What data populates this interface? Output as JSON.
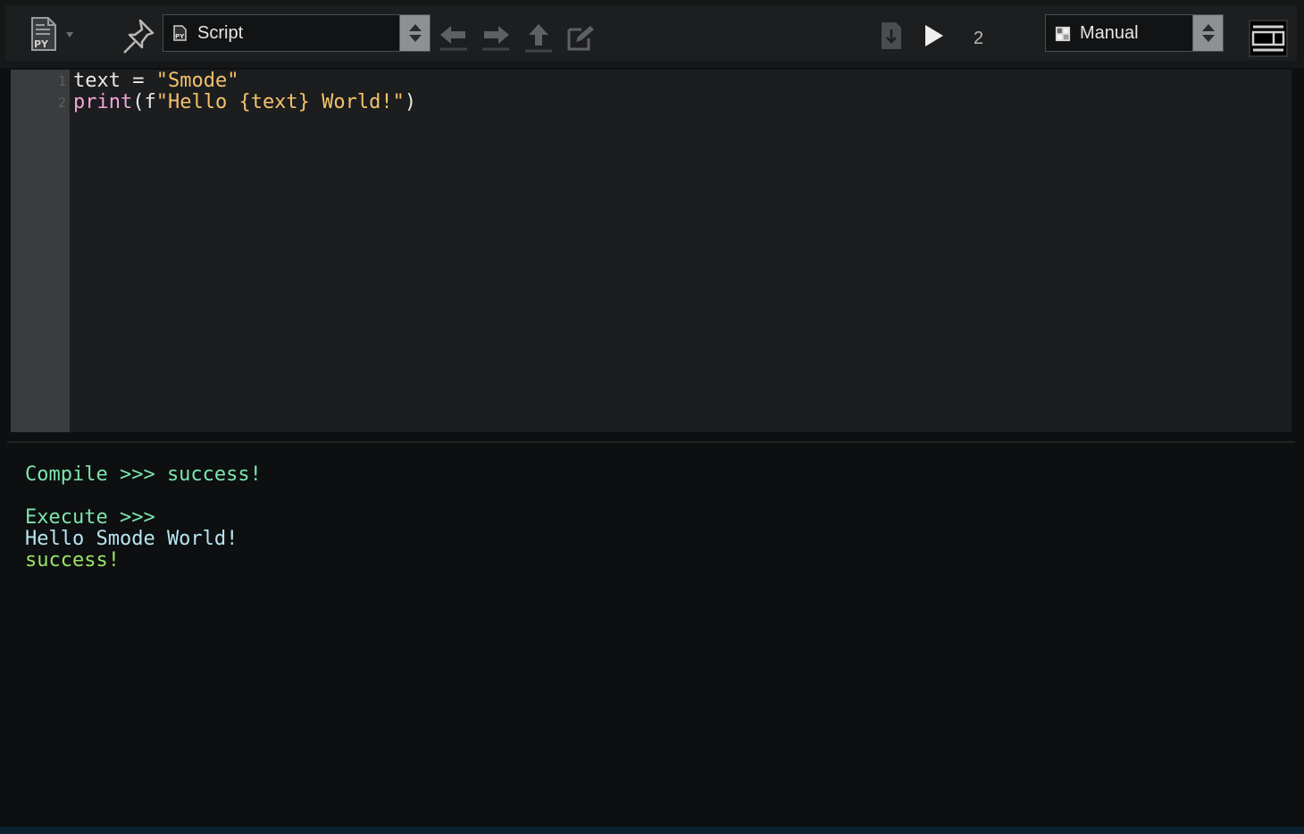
{
  "toolbar": {
    "script_selector": {
      "value": "Script",
      "icon": "python-file-icon"
    },
    "execution_mode": {
      "value": "Manual",
      "icon": "mode-grid-icon"
    },
    "run_count": "2",
    "icons": {
      "file_menu": "python-file-icon",
      "pin": "pin-icon",
      "back": "arrow-left-icon",
      "forward": "arrow-right-icon",
      "up": "arrow-up-icon",
      "edit": "edit-icon",
      "save": "download-icon",
      "play": "play-icon",
      "layout": "layout-icon"
    }
  },
  "editor": {
    "line_numbers": [
      "1",
      "2"
    ],
    "lines": [
      {
        "segments": [
          {
            "text": "text = ",
            "class": "pl"
          },
          {
            "text": "\"Smode\"",
            "class": "str"
          }
        ]
      },
      {
        "segments": [
          {
            "text": "print",
            "class": "kw"
          },
          {
            "text": "(f",
            "class": "pl"
          },
          {
            "text": "\"Hello {text} World!\"",
            "class": "str"
          },
          {
            "text": ")",
            "class": "pl"
          }
        ]
      }
    ]
  },
  "console": {
    "lines": [
      {
        "text": "Compile >>> success!",
        "class": "c-status"
      },
      {
        "text": "",
        "class": "c-status"
      },
      {
        "text": "Execute >>>",
        "class": "c-status"
      },
      {
        "text": "Hello Smode World!",
        "class": "c-out"
      },
      {
        "text": "success!",
        "class": "c-success"
      }
    ]
  },
  "colors": {
    "background": "#0d0f10",
    "editor_bg": "#1c1d1f",
    "gutter_bg": "#3b3c3e",
    "keyword": "#f2a5d8",
    "string": "#f4c26b",
    "console_status": "#7ee5ad",
    "console_output": "#b9e4f2",
    "console_success": "#9be46a"
  }
}
